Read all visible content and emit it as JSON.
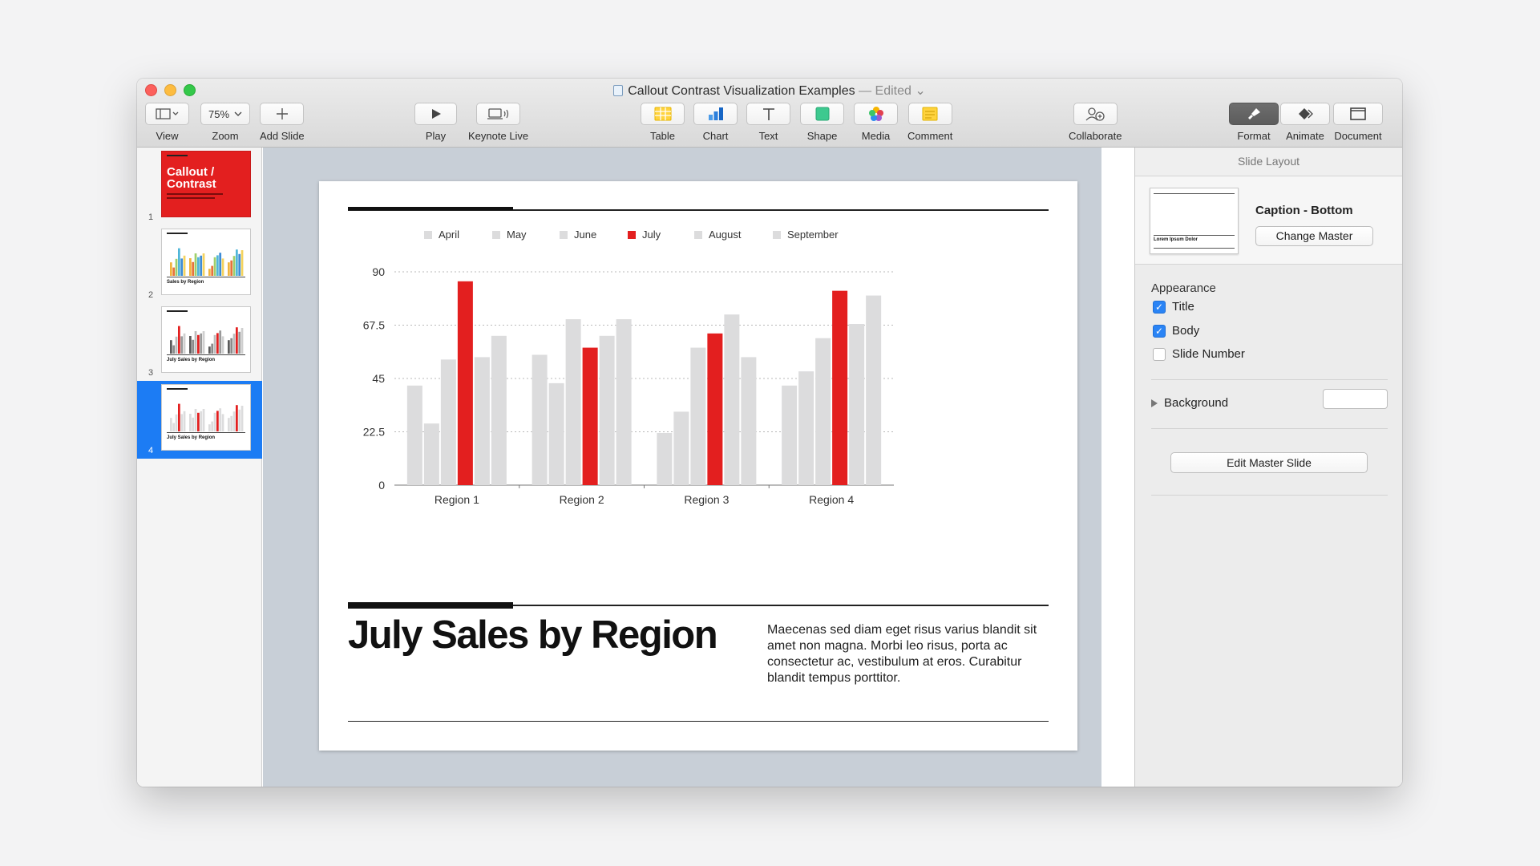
{
  "window": {
    "title": "Callout Contrast Visualization Examples",
    "edited": "— Edited ⌄"
  },
  "toolbar": {
    "view": "View",
    "zoom_value": "75%",
    "zoom": "Zoom",
    "add_slide": "Add Slide",
    "play": "Play",
    "keynote_live": "Keynote Live",
    "table": "Table",
    "chart": "Chart",
    "text": "Text",
    "shape": "Shape",
    "media": "Media",
    "comment": "Comment",
    "collaborate": "Collaborate",
    "format": "Format",
    "animate": "Animate",
    "document": "Document"
  },
  "navigator": {
    "slides": [
      {
        "num": "1",
        "title_line1": "Callout /",
        "title_line2": "Contrast"
      },
      {
        "num": "2",
        "caption": "Sales by Region"
      },
      {
        "num": "3",
        "caption": "July Sales by Region"
      },
      {
        "num": "4",
        "caption": "July Sales by Region",
        "selected": true
      }
    ]
  },
  "slide": {
    "title": "July Sales by Region",
    "body": "Maecenas sed diam eget risus varius blandit sit amet non magna. Morbi leo risus, porta ac consectetur ac, vestibulum at eros. Curabitur blandit tempus porttitor."
  },
  "chart_data": {
    "type": "bar",
    "categories": [
      "Region 1",
      "Region 2",
      "Region 3",
      "Region 4"
    ],
    "series": [
      {
        "name": "April",
        "values": [
          42,
          55,
          22,
          42
        ],
        "color": "#dcdcdd"
      },
      {
        "name": "May",
        "values": [
          26,
          43,
          31,
          48
        ],
        "color": "#dcdcdd"
      },
      {
        "name": "June",
        "values": [
          53,
          70,
          58,
          62
        ],
        "color": "#dcdcdd"
      },
      {
        "name": "July",
        "values": [
          86,
          58,
          64,
          82
        ],
        "color": "#e31f1f"
      },
      {
        "name": "August",
        "values": [
          54,
          63,
          72,
          68
        ],
        "color": "#dcdcdd"
      },
      {
        "name": "September",
        "values": [
          63,
          70,
          54,
          80
        ],
        "color": "#dcdcdd"
      }
    ],
    "ylim": [
      0,
      90
    ],
    "yticks": [
      "0",
      "22.5",
      "45",
      "67.5",
      "90"
    ],
    "grid": true,
    "legend": "top"
  },
  "inspector": {
    "header": "Slide Layout",
    "layout_name": "Caption - Bottom",
    "change_master": "Change Master",
    "thumb_caption": "Lorem Ipsum Dolor",
    "appearance": "Appearance",
    "checks": [
      {
        "label": "Title",
        "checked": true
      },
      {
        "label": "Body",
        "checked": true
      },
      {
        "label": "Slide Number",
        "checked": false
      }
    ],
    "background": "Background",
    "edit_master": "Edit Master Slide"
  }
}
